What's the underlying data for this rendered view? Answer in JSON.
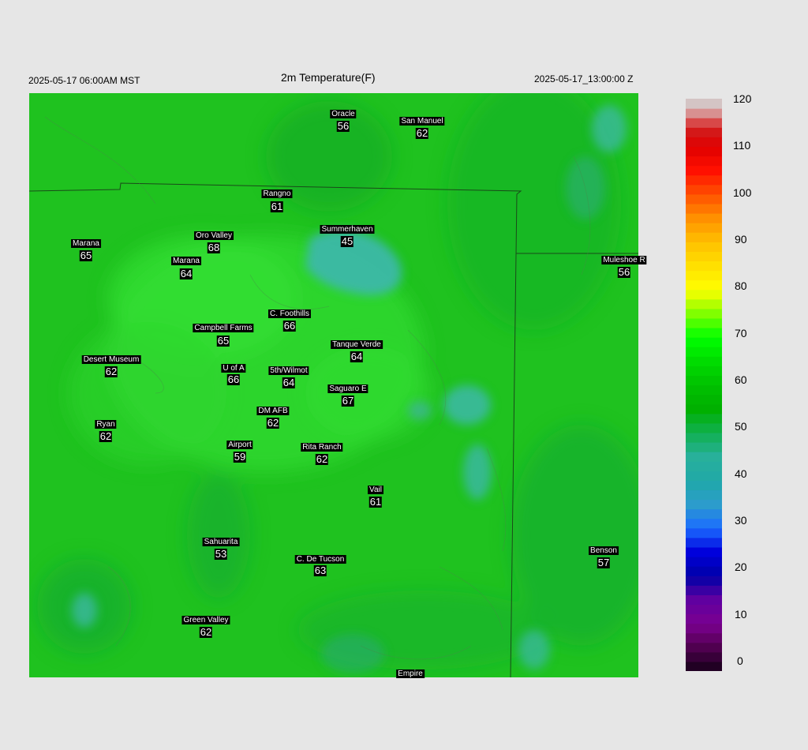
{
  "header": {
    "local_time": "2025-05-17 06:00AM MST",
    "title": "2m Temperature(F)",
    "utc_time": "2025-05-17_13:00:00 Z"
  },
  "stations": [
    {
      "name": "Oracle",
      "value": "56"
    },
    {
      "name": "San Manuel",
      "value": "62"
    },
    {
      "name": "Rangno",
      "value": "61"
    },
    {
      "name": "Summerhaven",
      "value": "45"
    },
    {
      "name": "Marana",
      "value": "65"
    },
    {
      "name": "Oro Valley",
      "value": "68"
    },
    {
      "name": "Marana",
      "value": "64"
    },
    {
      "name": "Muleshoe R",
      "value": "56"
    },
    {
      "name": "C. Foothills",
      "value": "66"
    },
    {
      "name": "Campbell Farms",
      "value": "65"
    },
    {
      "name": "Tanque Verde",
      "value": "64"
    },
    {
      "name": "Desert Museum",
      "value": "62"
    },
    {
      "name": "U of A",
      "value": "66"
    },
    {
      "name": "5th/Wilmot",
      "value": "64"
    },
    {
      "name": "Saguaro E",
      "value": "67"
    },
    {
      "name": "DM AFB",
      "value": "62"
    },
    {
      "name": "Ryan",
      "value": "62"
    },
    {
      "name": "Airport",
      "value": "59"
    },
    {
      "name": "Rita Ranch",
      "value": "62"
    },
    {
      "name": "Vail",
      "value": "61"
    },
    {
      "name": "Sahuarita",
      "value": "53"
    },
    {
      "name": "C. De Tucson",
      "value": "63"
    },
    {
      "name": "Benson",
      "value": "57"
    },
    {
      "name": "Green Valley",
      "value": "62"
    },
    {
      "name": "Empire",
      "value": ""
    }
  ],
  "colorbar": {
    "ticks": [
      "120",
      "110",
      "100",
      "90",
      "80",
      "70",
      "60",
      "50",
      "40",
      "30",
      "20",
      "10",
      "0"
    ],
    "min": 0,
    "max": 120
  },
  "colors": {
    "background": "#e6e6e6",
    "map_base": "#1fc21f",
    "high_terrain_cool": "#3cb8a8",
    "warm_valley": "#30e030"
  }
}
